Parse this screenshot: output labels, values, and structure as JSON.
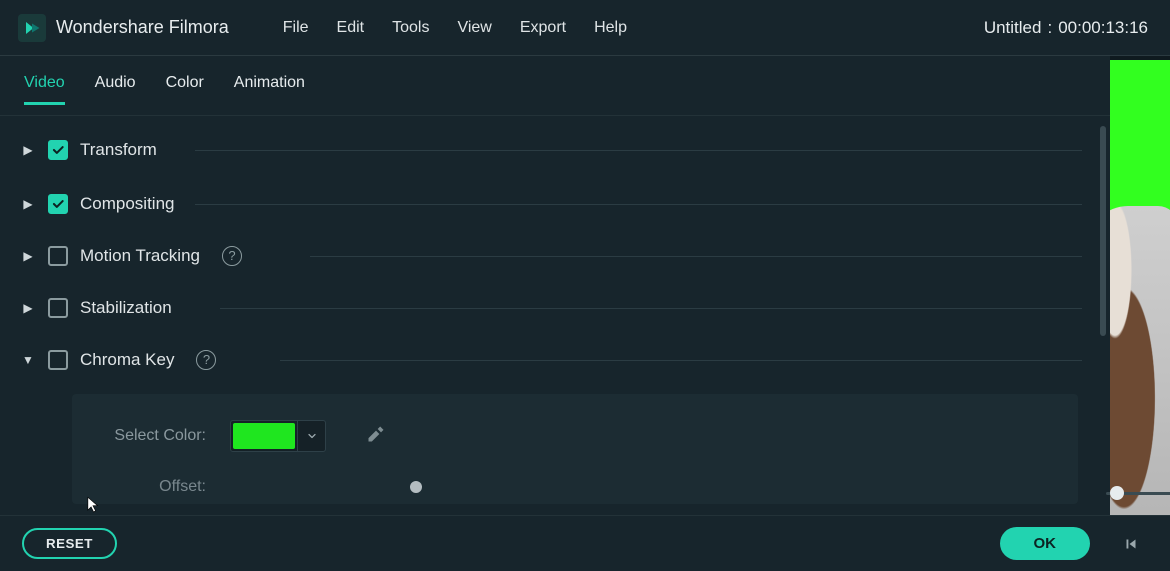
{
  "app": {
    "name": "Wondershare Filmora"
  },
  "menu": {
    "file": "File",
    "edit": "Edit",
    "tools": "Tools",
    "view": "View",
    "export": "Export",
    "help": "Help"
  },
  "titlebar": {
    "project": "Untitled",
    "sep": ":",
    "timecode": "00:00:13:16"
  },
  "tabs": {
    "video": "Video",
    "audio": "Audio",
    "color": "Color",
    "animation": "Animation",
    "active": "video"
  },
  "sections": {
    "transform": {
      "label": "Transform",
      "checked": true,
      "expanded": false,
      "info": false
    },
    "compositing": {
      "label": "Compositing",
      "checked": true,
      "expanded": false,
      "info": false
    },
    "motionTracking": {
      "label": "Motion Tracking",
      "checked": false,
      "expanded": false,
      "info": true
    },
    "stabilization": {
      "label": "Stabilization",
      "checked": false,
      "expanded": false,
      "info": false
    },
    "chromaKey": {
      "label": "Chroma Key",
      "checked": false,
      "expanded": true,
      "info": true
    }
  },
  "chromaKey": {
    "selectColorLabel": "Select Color:",
    "colorHex": "#1fe61f",
    "offsetLabel": "Offset:",
    "offsetValue": 0
  },
  "buttons": {
    "reset": "RESET",
    "ok": "OK"
  },
  "icons": {
    "logo": "filmora-logo-icon",
    "check": "check-icon",
    "info": "info-icon",
    "triRight": "disclosure-right-icon",
    "triDown": "disclosure-down-icon",
    "chevronDown": "chevron-down-icon",
    "eyedropper": "eyedropper-icon",
    "stepPrev": "step-prev-icon"
  }
}
